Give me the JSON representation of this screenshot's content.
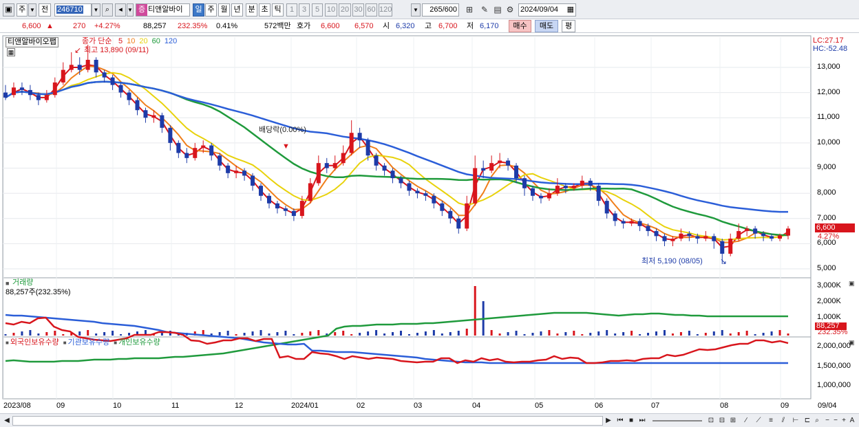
{
  "toolbar": {
    "period_label": "주",
    "prev_label": "전",
    "code": "246710",
    "stock_badge": "증",
    "stock_name": "티앤알바이",
    "tabs": [
      "일",
      "주",
      "월",
      "년",
      "분",
      "초",
      "틱"
    ],
    "selected_tab": "일",
    "intervals": [
      "1",
      "3",
      "5",
      "10",
      "20",
      "30",
      "60",
      "120"
    ],
    "count": "265",
    "count_total": "/600",
    "date": "2024/09/04"
  },
  "quote": {
    "price": "6,600",
    "change_arrow": "▲",
    "change": "270",
    "change_pct": "+4.27%",
    "volume": "88,257",
    "volume_pct": "232.35%",
    "turnover": "0.41%",
    "amount": "572백만",
    "bid_label": "호가",
    "bid1": "6,600",
    "bid2": "6,570",
    "open_label": "시",
    "open": "6,320",
    "high_label": "고",
    "high": "6,700",
    "low_label": "저",
    "low": "6,170",
    "buy_label": "매수",
    "sell_label": "매도",
    "avg_label": "평"
  },
  "price_panel": {
    "name": "티앤알바이오팹",
    "ma_title": "종가 단순",
    "ma_periods": [
      {
        "label": "5",
        "color": "#d8151c"
      },
      {
        "label": "10",
        "color": "#f07e1a"
      },
      {
        "label": "20",
        "color": "#e8d20c"
      },
      {
        "label": "60",
        "color": "#1f9a3c"
      },
      {
        "label": "120",
        "color": "#2b5ed8"
      }
    ],
    "lc": "LC:27.17",
    "hc": "HC:-52.48",
    "high_note": "최고 13,890 (09/11)",
    "low_note": "최저 5,190 (08/05)",
    "dividend_note": "배당락(0.00%)",
    "current_price_tag": "6,600",
    "current_pct_tag": "4.27%",
    "y_ticks": [
      "13,000",
      "12,000",
      "11,000",
      "10,000",
      "9,000",
      "8,000",
      "7,000",
      "6,000",
      "5,000"
    ]
  },
  "volume_panel": {
    "title": "거래량",
    "current": "88,257주(232.35%)",
    "y_ticks": [
      "3,000K",
      "2,000K",
      "1,000K"
    ],
    "tag_value": "88,257",
    "tag_pct": "232.35%"
  },
  "holdings_panel": {
    "legend": [
      "외국인보유수량",
      "기관보유수량",
      "개인보유수량"
    ],
    "colors": [
      "#d8151c",
      "#2b5ed8",
      "#1f9a3c"
    ],
    "y_ticks": [
      "2,000,000",
      "1,500,000",
      "1,000,000"
    ]
  },
  "x_axis": [
    "2023/08",
    "09",
    "10",
    "11",
    "12",
    "2024/01",
    "02",
    "03",
    "04",
    "05",
    "06",
    "07",
    "08",
    "09"
  ],
  "x_axis_right": "09/04",
  "chart_data": {
    "type": "line",
    "price_y_range": [
      4700,
      14200
    ],
    "candles_approx": [
      [
        12000,
        11800,
        12300,
        11700
      ],
      [
        11900,
        12200,
        12400,
        11800
      ],
      [
        12200,
        12100,
        12400,
        11900
      ],
      [
        12100,
        11900,
        12300,
        11700
      ],
      [
        11900,
        11700,
        12000,
        11500
      ],
      [
        11700,
        11900,
        12100,
        11600
      ],
      [
        11900,
        12400,
        12600,
        11800
      ],
      [
        12400,
        12900,
        13200,
        12300
      ],
      [
        12900,
        13100,
        13600,
        12800
      ],
      [
        13100,
        12900,
        13400,
        12700
      ],
      [
        12900,
        13300,
        13900,
        12800
      ],
      [
        13300,
        12800,
        13400,
        12600
      ],
      [
        12800,
        12600,
        12900,
        12400
      ],
      [
        12600,
        12300,
        12700,
        12100
      ],
      [
        12300,
        12000,
        12400,
        11800
      ],
      [
        12000,
        11700,
        12100,
        11500
      ],
      [
        11700,
        11300,
        11800,
        11100
      ],
      [
        11300,
        11000,
        11400,
        10800
      ],
      [
        11000,
        11100,
        11300,
        10800
      ],
      [
        11100,
        10600,
        11200,
        10400
      ],
      [
        10600,
        10000,
        10700,
        9700
      ],
      [
        10000,
        9600,
        10100,
        9400
      ],
      [
        9600,
        9400,
        9800,
        9200
      ],
      [
        9400,
        9800,
        10000,
        9300
      ],
      [
        9800,
        9900,
        10100,
        9600
      ],
      [
        9900,
        9500,
        10000,
        9300
      ],
      [
        9500,
        9100,
        9600,
        8900
      ],
      [
        9100,
        8800,
        9200,
        8600
      ],
      [
        8800,
        8900,
        9100,
        8600
      ],
      [
        8900,
        8700,
        9000,
        8500
      ],
      [
        8700,
        8300,
        8800,
        8100
      ],
      [
        8300,
        7900,
        8400,
        7700
      ],
      [
        7900,
        7600,
        8000,
        7400
      ],
      [
        7600,
        7400,
        7700,
        7200
      ],
      [
        7400,
        7300,
        7500,
        7100
      ],
      [
        7300,
        7100,
        7400,
        6900
      ],
      [
        7100,
        7700,
        7900,
        7000
      ],
      [
        7700,
        8400,
        8600,
        7600
      ],
      [
        8400,
        9200,
        9500,
        8300
      ],
      [
        9200,
        9000,
        9400,
        8800
      ],
      [
        9000,
        9200,
        9500,
        8900
      ],
      [
        9200,
        9600,
        9900,
        9100
      ],
      [
        9600,
        10400,
        10900,
        9500
      ],
      [
        10400,
        10100,
        10600,
        9800
      ],
      [
        10100,
        9500,
        10200,
        9300
      ],
      [
        9500,
        9100,
        9600,
        8900
      ],
      [
        9100,
        8900,
        9200,
        8700
      ],
      [
        8900,
        8600,
        9000,
        8400
      ],
      [
        8600,
        8400,
        8700,
        8200
      ],
      [
        8400,
        8100,
        8500,
        7900
      ],
      [
        8100,
        8000,
        8200,
        7800
      ],
      [
        8000,
        7900,
        8100,
        7700
      ],
      [
        7900,
        7600,
        8000,
        7400
      ],
      [
        7600,
        7300,
        7700,
        7100
      ],
      [
        7300,
        7000,
        7400,
        6800
      ],
      [
        7000,
        6600,
        7100,
        6400
      ],
      [
        6600,
        7600,
        7900,
        6500
      ],
      [
        7600,
        9000,
        9500,
        7500
      ],
      [
        9000,
        8900,
        9300,
        8600
      ],
      [
        8900,
        9200,
        9500,
        8800
      ],
      [
        9200,
        9300,
        9600,
        9000
      ],
      [
        9300,
        9100,
        9400,
        8900
      ],
      [
        9100,
        8600,
        9200,
        8400
      ],
      [
        8600,
        8200,
        8700,
        7900
      ],
      [
        8200,
        7900,
        8300,
        7700
      ],
      [
        7900,
        7800,
        8000,
        7600
      ],
      [
        7800,
        8000,
        8200,
        7700
      ],
      [
        8000,
        8300,
        8600,
        7900
      ],
      [
        8300,
        8200,
        8400,
        8000
      ],
      [
        8200,
        8300,
        8400,
        8100
      ],
      [
        8300,
        8500,
        8700,
        8200
      ],
      [
        8500,
        8300,
        8600,
        8100
      ],
      [
        8300,
        7700,
        8400,
        7500
      ],
      [
        7700,
        7200,
        7800,
        7000
      ],
      [
        7200,
        6900,
        7300,
        6700
      ],
      [
        6900,
        6800,
        7000,
        6600
      ],
      [
        6800,
        6900,
        7000,
        6700
      ],
      [
        6900,
        6700,
        7000,
        6500
      ],
      [
        6700,
        6500,
        6800,
        6300
      ],
      [
        6500,
        6300,
        6600,
        6100
      ],
      [
        6300,
        6100,
        6400,
        5900
      ],
      [
        6100,
        6200,
        6300,
        5900
      ],
      [
        6200,
        6400,
        6600,
        6100
      ],
      [
        6400,
        6300,
        6500,
        6100
      ],
      [
        6300,
        6200,
        6400,
        6000
      ],
      [
        6200,
        6300,
        6500,
        6100
      ],
      [
        6300,
        6100,
        6400,
        5800
      ],
      [
        6100,
        5600,
        6200,
        5190
      ],
      [
        5600,
        6200,
        6400,
        5500
      ],
      [
        6200,
        6500,
        6800,
        6100
      ],
      [
        6500,
        6600,
        6700,
        6300
      ],
      [
        6600,
        6400,
        6700,
        6200
      ],
      [
        6400,
        6300,
        6500,
        6100
      ],
      [
        6300,
        6200,
        6400,
        6100
      ],
      [
        6200,
        6330,
        6400,
        6100
      ],
      [
        6320,
        6600,
        6700,
        6170
      ]
    ]
  }
}
